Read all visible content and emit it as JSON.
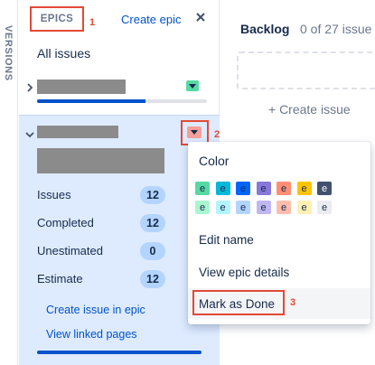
{
  "sidebar": {
    "versions_label": "VERSIONS"
  },
  "epics_panel": {
    "tab_label": "EPICS",
    "create_epic_label": "Create epic",
    "all_issues_label": "All issues",
    "epic1": {
      "progress_percent": 64,
      "color": "#57d9a3"
    },
    "epic2": {
      "color": "#f79f9a",
      "stats": [
        {
          "label": "Issues",
          "value": "12"
        },
        {
          "label": "Completed",
          "value": "12"
        },
        {
          "label": "Unestimated",
          "value": "0"
        },
        {
          "label": "Estimate",
          "value": "12"
        }
      ],
      "links": {
        "create_issue": "Create issue in epic",
        "view_linked": "View linked pages"
      },
      "progress_percent": 100
    }
  },
  "backlog": {
    "title": "Backlog",
    "count": "0 of 27 issue",
    "create_issue_label": "+ Create issue"
  },
  "menu": {
    "color_heading": "Color",
    "swatch_letter": "e",
    "swatch_row1": [
      "#57d9a3",
      "#00b8d9",
      "#0065ff",
      "#8777d9",
      "#ff8f73",
      "#ffc400",
      "#42526e"
    ],
    "swatch_row2": [
      "#abf5d1",
      "#b3f5ff",
      "#b3d4ff",
      "#c0b6f2",
      "#ffbdad",
      "#fff0b3",
      "#ebecf0"
    ],
    "items": {
      "edit_name": "Edit name",
      "view_details": "View epic details",
      "mark_done": "Mark as Done"
    }
  },
  "annotations": {
    "a1": "1",
    "a2": "2",
    "a3": "3"
  }
}
